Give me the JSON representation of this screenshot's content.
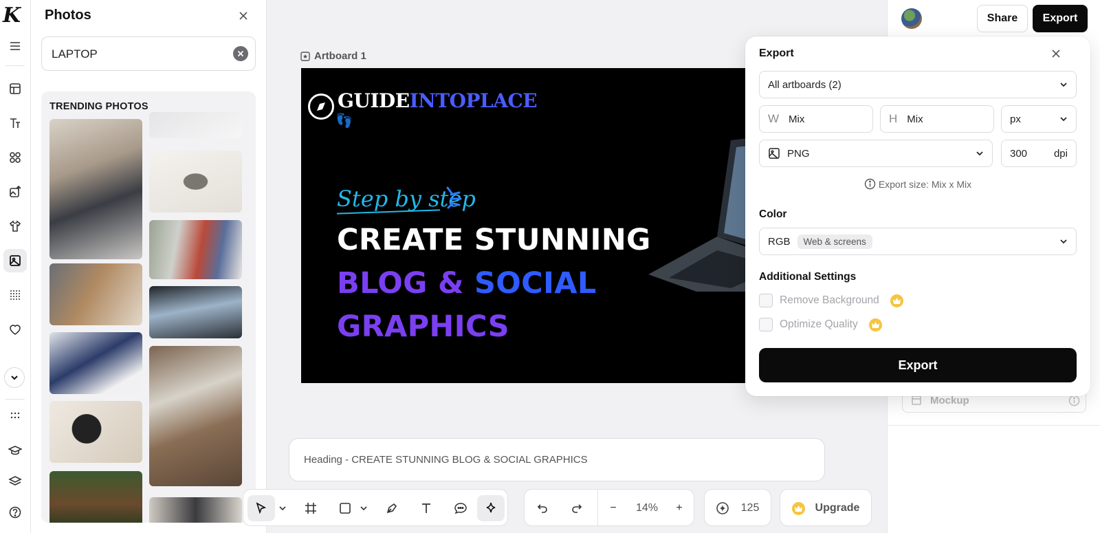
{
  "app": {
    "logo_letter": "K"
  },
  "rail": {
    "items": [
      "menu-icon",
      "layout-icon",
      "text-icon",
      "elements-icon",
      "uploads-icon",
      "tshirt-icon",
      "photos-icon",
      "patterns-icon",
      "favorites-icon",
      "collapse-icon",
      "apps-icon",
      "learn-icon",
      "layers-icon",
      "help-icon"
    ],
    "active": "photos-icon"
  },
  "photos_panel": {
    "title": "Photos",
    "search_value": "LAPTOP",
    "section_title": "TRENDING PHOTOS"
  },
  "canvas": {
    "artboard_label": "Artboard 1",
    "artboard": {
      "brand_white": "GUIDE",
      "brand_purple": "INTOPLACE",
      "script_text": "Step by step",
      "line1": "CREATE STUNNING",
      "line2a": "BLOG & ",
      "line2b": "SOCIAL",
      "line3": "GRAPHICS",
      "colors": {
        "purple": "#7b3ff2",
        "blue": "#2f5bff",
        "white": "#ffffff",
        "cyan": "#22b8e8"
      }
    },
    "heading_bar": "Heading - CREATE STUNNING BLOG & SOCIAL GRAPHICS"
  },
  "toolbar": {
    "zoom": "14%",
    "credits": "125",
    "upgrade": "Upgrade",
    "zoom_out": "−",
    "zoom_in": "+"
  },
  "header": {
    "share": "Share",
    "export": "Export"
  },
  "right_panel": {
    "mockup": "Mockup"
  },
  "export_popover": {
    "title": "Export",
    "artboards": "All artboards (2)",
    "width_label": "W",
    "width_value": "Mix",
    "height_label": "H",
    "height_value": "Mix",
    "unit": "px",
    "format": "PNG",
    "dpi_value": "300",
    "dpi_label": "dpi",
    "export_size": "Export size: Mix x Mix",
    "color_section": "Color",
    "color_mode": "RGB",
    "color_tag": "Web & screens",
    "additional_section": "Additional Settings",
    "remove_bg": "Remove Background",
    "optimize_quality": "Optimize Quality",
    "export_button": "Export"
  }
}
